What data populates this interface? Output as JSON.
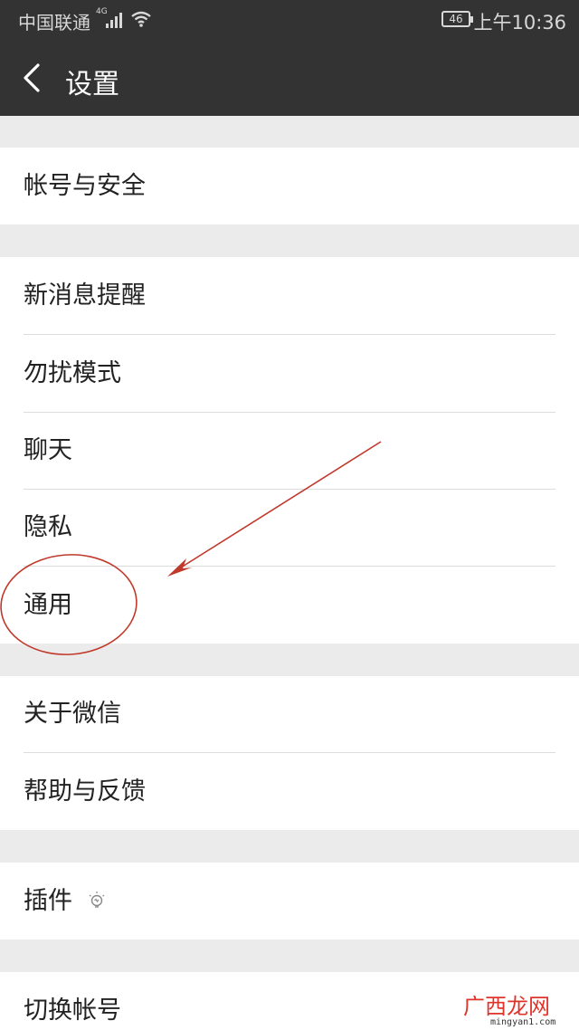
{
  "status_bar": {
    "carrier": "中国联通",
    "network": "4G",
    "battery": "46",
    "time": "上午10:36"
  },
  "header": {
    "back_icon": "chevron-left-icon",
    "title": "设置"
  },
  "groups": [
    {
      "items": [
        {
          "label": "帐号与安全"
        }
      ]
    },
    {
      "items": [
        {
          "label": "新消息提醒"
        },
        {
          "label": "勿扰模式"
        },
        {
          "label": "聊天"
        },
        {
          "label": "隐私"
        },
        {
          "label": "通用"
        }
      ]
    },
    {
      "items": [
        {
          "label": "关于微信"
        },
        {
          "label": "帮助与反馈"
        }
      ]
    },
    {
      "items": [
        {
          "label": "插件",
          "icon": "lightbulb-icon"
        }
      ]
    },
    {
      "items": [
        {
          "label": "切换帐号"
        }
      ]
    }
  ],
  "annotation": {
    "color": "#c0392b",
    "target": "通用"
  },
  "watermark": {
    "text": "广西龙网",
    "sub": "mingyan1.com"
  }
}
